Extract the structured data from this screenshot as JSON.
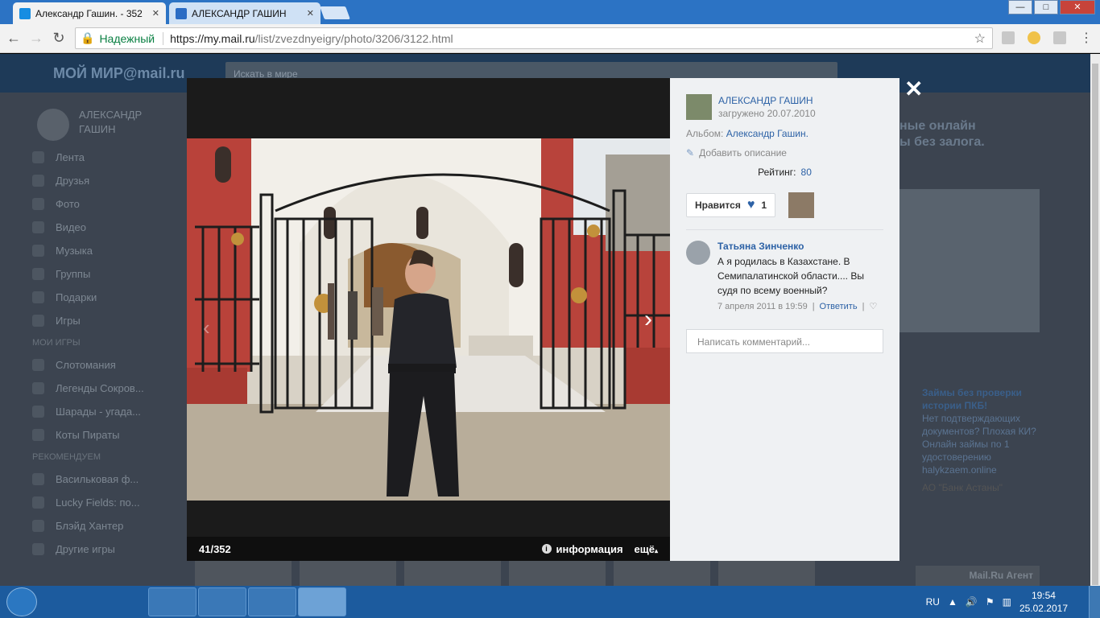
{
  "browser": {
    "tabs": [
      {
        "title": "Александр Гашин. - 352",
        "active": true
      },
      {
        "title": "АЛЕКСАНДР ГАШИН",
        "active": false
      }
    ],
    "window_buttons": {
      "minimize": "—",
      "maximize": "□",
      "close": "✕"
    },
    "secure_label": "Надежный",
    "url_host": "https://my.mail.ru",
    "url_path": "/list/zvezdnyeigry/photo/3206/3122.html"
  },
  "background": {
    "logo": "МОЙ МИР@mail.ru",
    "search_placeholder": "Искать в мире",
    "user_name": "АЛЕКСАНДР ГАШИН",
    "menu": [
      "Лента",
      "Друзья",
      "Фото",
      "Видео",
      "Музыка",
      "Группы",
      "Подарки",
      "Игры"
    ],
    "my_games_header": "МОИ ИГРЫ",
    "my_games": [
      "Слотомания",
      "Легенды Сокров...",
      "Шарады - угада...",
      "Коты Пираты"
    ],
    "recommended_header": "РЕКОМЕНДУЕМ",
    "recommended": [
      "Васильковая ф...",
      "Lucky Fields: по...",
      "Блэйд Хантер",
      "Другие игры"
    ],
    "ad1_title": "ные онлайн\nы без залога.",
    "ad2_title": "Займы без проверки истории ПКБ!",
    "ad2_text": "Нет подтверждающих документов? Плохая КИ? Онлайн займы по 1 удостоверению",
    "ad2_link": "halykzaem.online",
    "ad2_bank": "АО \"Банк Астаны\"",
    "agent": "Mail.Ru Агент"
  },
  "viewer": {
    "counter": "41/352",
    "info_label": "информация",
    "more_label": "ещё",
    "close_icon": "✕",
    "author_name": "АЛЕКСАНДР ГАШИН",
    "uploaded": "загружено 20.07.2010",
    "album_label": "Альбом:",
    "album_name": "Александр Гашин.",
    "add_description": "Добавить описание",
    "rating_label": "Рейтинг:",
    "rating_value": "80",
    "like_label": "Нравится",
    "like_count": "1",
    "comments": [
      {
        "author": "Татьяна Зинченко",
        "text": "А я родилась в Казахстане. В Семипалатинской области.... Вы судя по всему военный?",
        "date": "7 апреля 2011 в 19:59",
        "reply": "Ответить"
      }
    ],
    "comment_placeholder": "Написать комментарий..."
  },
  "taskbar": {
    "lang": "RU",
    "time": "19:54",
    "date": "25.02.2017"
  }
}
